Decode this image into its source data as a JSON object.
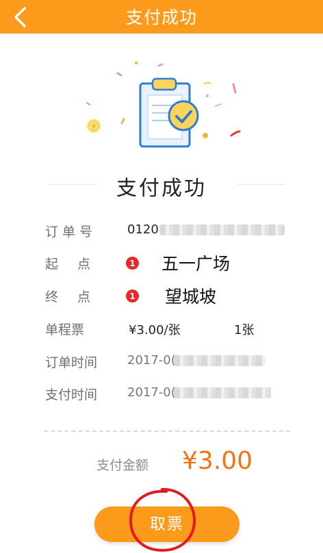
{
  "header": {
    "title": "支付成功",
    "back_icon": "chevron-left-icon"
  },
  "illustration": {
    "icon": "clipboard-check-icon",
    "coin_symbol": "¥"
  },
  "main": {
    "title": "支付成功"
  },
  "order": {
    "order_no_label": "订单号",
    "order_no_value": "0120",
    "start_label": "起点",
    "start_badge": "1",
    "start_station": "五一广场",
    "end_label": "终点",
    "end_badge": "1",
    "end_station": "望城坡",
    "fare_label": "单程票",
    "fare_value": "¥3.00/张",
    "quantity": "1张",
    "order_time_label": "订单时间",
    "order_time_value": "2017-0(",
    "pay_time_label": "支付时间",
    "pay_time_value": "2017-0("
  },
  "payment": {
    "amount_label": "支付金额",
    "amount_value": "¥3.00"
  },
  "actions": {
    "ticket_button_label": "取票"
  },
  "colors": {
    "brand": "#fc9a1c",
    "amount": "#f4730f",
    "badge": "#e4282b",
    "annotation": "#e31b1b"
  }
}
